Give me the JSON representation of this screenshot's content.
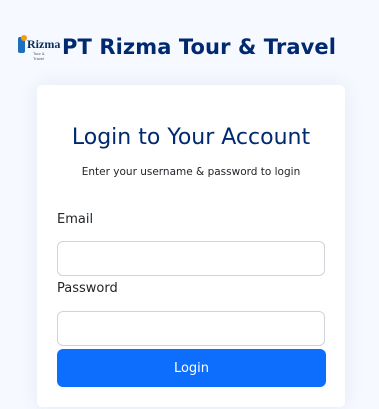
{
  "brand": {
    "logo_word": "Rizma",
    "logo_tagline": "Tour & Travel",
    "title": "PT Rizma Tour & Travel"
  },
  "login": {
    "title": "Login to Your Account",
    "subtitle": "Enter your username & password to login",
    "email_label": "Email",
    "email_value": "",
    "password_label": "Password",
    "password_value": "",
    "button_label": "Login"
  },
  "colors": {
    "brand_navy": "#012970",
    "primary": "#0d6efd",
    "background": "#f6f9ff"
  }
}
